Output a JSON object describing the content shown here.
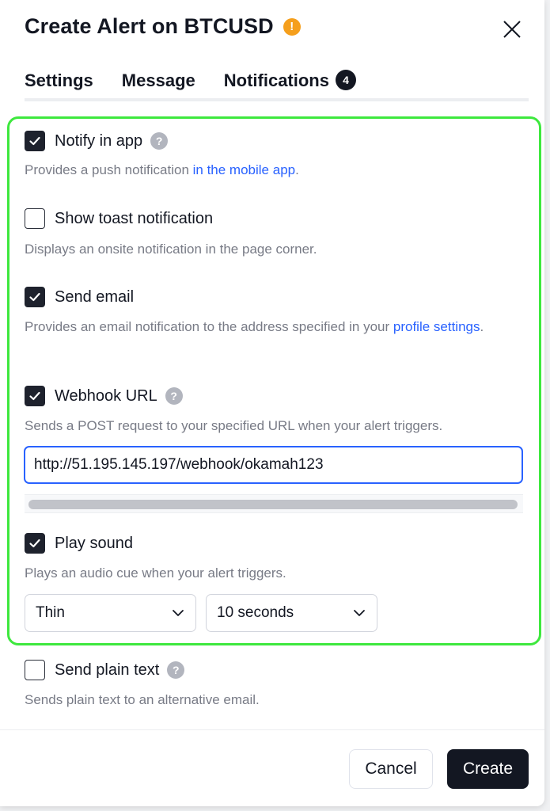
{
  "dialog": {
    "title": "Create Alert on BTCUSD",
    "warning_icon": "exclamation-circle-icon",
    "warning_glyph": "!",
    "close_icon": "close-icon"
  },
  "tabs": [
    {
      "label": "Settings",
      "active": false
    },
    {
      "label": "Message",
      "active": false
    },
    {
      "label": "Notifications",
      "active": true,
      "badge": "4"
    }
  ],
  "help_glyph": "?",
  "options": {
    "notify_app": {
      "label": "Notify in app",
      "checked": true,
      "desc_prefix": "Provides a push notification ",
      "desc_link": "in the mobile app",
      "desc_suffix": "."
    },
    "toast": {
      "label": "Show toast notification",
      "checked": false,
      "desc": "Displays an onsite notification in the page corner."
    },
    "email": {
      "label": "Send email",
      "checked": true,
      "desc_prefix": "Provides an email notification to the address specified in your ",
      "desc_link": "profile settings",
      "desc_suffix": "."
    },
    "webhook": {
      "label": "Webhook URL",
      "checked": true,
      "desc": "Sends a POST request to your specified URL when your alert triggers.",
      "url_value": "http://51.195.145.197/webhook/okamah123"
    },
    "sound": {
      "label": "Play sound",
      "checked": true,
      "desc": "Plays an audio cue when your alert triggers.",
      "sound_select": "Thin",
      "duration_select": "10 seconds"
    },
    "plain_text": {
      "label": "Send plain text",
      "checked": false,
      "desc": "Sends plain text to an alternative email."
    }
  },
  "footer": {
    "cancel_label": "Cancel",
    "create_label": "Create"
  },
  "colors": {
    "accent_link": "#2962ff",
    "highlight_border": "#3ee83e",
    "warning": "#f59f1c",
    "primary_button": "#131722"
  }
}
